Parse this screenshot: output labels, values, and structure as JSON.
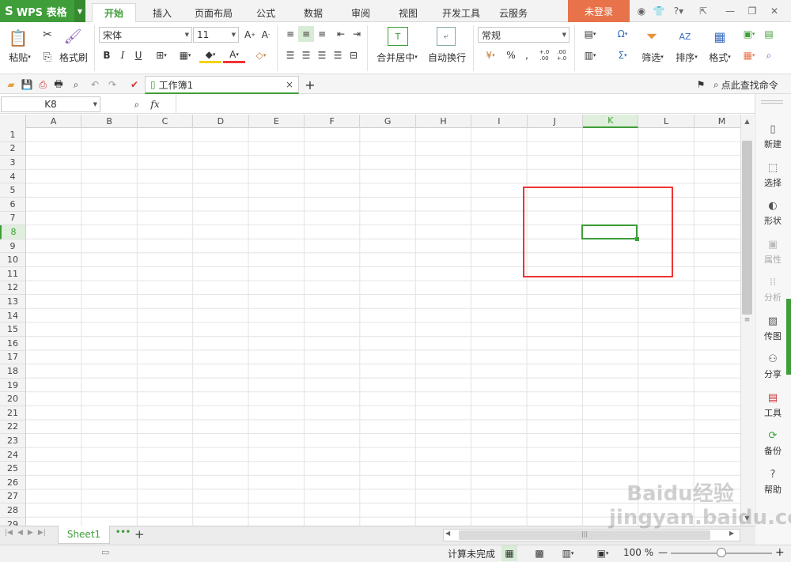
{
  "app": {
    "logo": "WPS 表格",
    "logo_mark": "S"
  },
  "tabs": [
    {
      "label": "开始"
    },
    {
      "label": "插入"
    },
    {
      "label": "页面布局"
    },
    {
      "label": "公式"
    },
    {
      "label": "数据"
    },
    {
      "label": "审阅"
    },
    {
      "label": "视图"
    },
    {
      "label": "开发工具"
    },
    {
      "label": "云服务"
    }
  ],
  "login": "未登录",
  "ribbon": {
    "paste": "粘贴",
    "cut_dropdown": "▾",
    "format_painter": "格式刷",
    "font_name": "宋体",
    "font_size": "11",
    "bold": "B",
    "italic": "I",
    "underline": "U",
    "merge_center": "合并居中",
    "wrap_text": "自动换行",
    "number_format": "常规",
    "percent": "%",
    "comma": ",",
    "inc_decimal": "+.0 .00",
    "dec_decimal": ".00 +.0",
    "filter": "筛选",
    "sort": "排序",
    "format": "格式",
    "sum": "Σ",
    "omega": "Ω"
  },
  "doc_tab": {
    "name": "工作簿1",
    "close": "×",
    "add": "+"
  },
  "search_cmd": "点此查找命令",
  "formula": {
    "cell_ref": "K8",
    "fx": "fx",
    "value": ""
  },
  "columns": [
    "A",
    "B",
    "C",
    "D",
    "E",
    "F",
    "G",
    "H",
    "I",
    "J",
    "K",
    "L",
    "M"
  ],
  "selected_column": "K",
  "rows": [
    "1",
    "2",
    "3",
    "4",
    "5",
    "6",
    "7",
    "8",
    "9",
    "10",
    "11",
    "12",
    "13",
    "14",
    "15",
    "16",
    "17",
    "18",
    "19",
    "20",
    "21",
    "22",
    "23",
    "24",
    "25",
    "26",
    "27",
    "28",
    "29"
  ],
  "selected_row": "8",
  "right_panel": [
    {
      "label": "新建",
      "icon": "new-icon"
    },
    {
      "label": "选择",
      "icon": "select-icon"
    },
    {
      "label": "形状",
      "icon": "shape-icon"
    },
    {
      "label": "属性",
      "icon": "property-icon"
    },
    {
      "label": "分析",
      "icon": "analysis-icon"
    },
    {
      "label": "传图",
      "icon": "upload-image-icon"
    },
    {
      "label": "分享",
      "icon": "share-icon"
    },
    {
      "label": "工具",
      "icon": "toolbox-icon"
    },
    {
      "label": "备份",
      "icon": "backup-icon"
    },
    {
      "label": "帮助",
      "icon": "help-icon"
    }
  ],
  "sheets": [
    {
      "name": "Sheet1"
    }
  ],
  "sheet_more": "•••",
  "sheet_add": "+",
  "status": {
    "calc": "计算未完成",
    "zoom": "100 %"
  },
  "watermark": "Baidu经验 jingyan.baidu.com",
  "colors": {
    "accent": "#3f9d3a",
    "login": "#e8734a",
    "highlight": "#e33333"
  }
}
